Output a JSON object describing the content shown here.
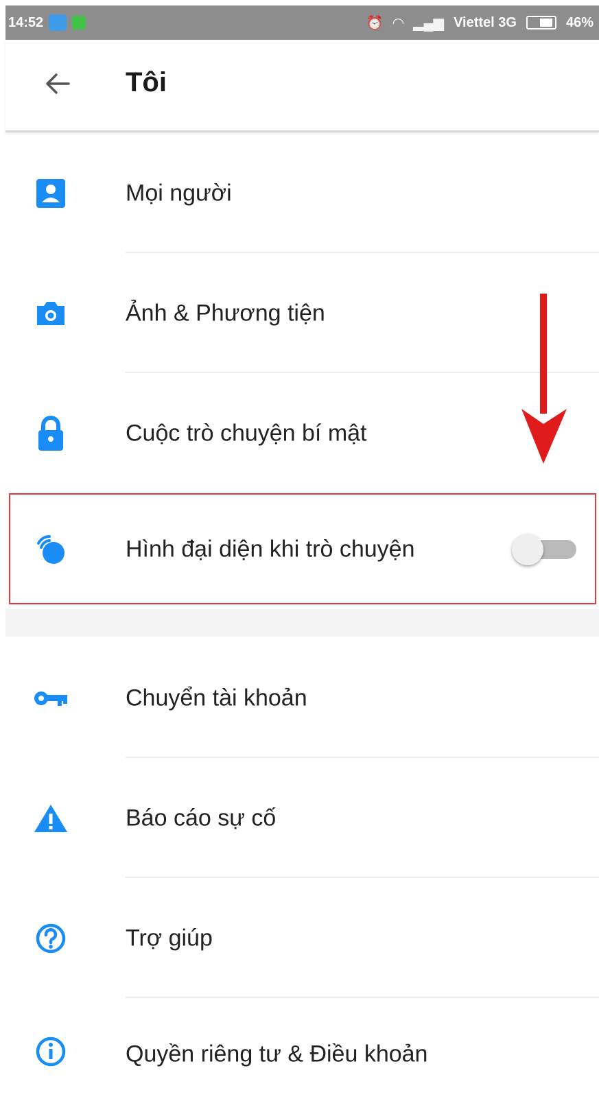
{
  "status_bar": {
    "time": "14:52",
    "carrier": "Viettel 3G",
    "battery": "46%"
  },
  "header": {
    "title": "Tôi"
  },
  "menu": {
    "items": [
      {
        "label": "Mọi người",
        "icon": "contacts-icon"
      },
      {
        "label": "Ảnh & Phương tiện",
        "icon": "camera-icon"
      },
      {
        "label": "Cuộc trò chuyện bí mật",
        "icon": "lock-icon"
      },
      {
        "label": "Hình đại diện khi trò chuyện",
        "icon": "chat-heads-icon",
        "toggle": false
      },
      {
        "label": "Chuyển tài khoản",
        "icon": "key-icon"
      },
      {
        "label": "Báo cáo sự cố",
        "icon": "warning-icon"
      },
      {
        "label": "Trợ giúp",
        "icon": "help-icon"
      },
      {
        "label": "Quyền riêng tư & Điều khoản",
        "icon": "info-icon"
      }
    ]
  },
  "colors": {
    "accent": "#1a8cf5",
    "highlight_border": "#e23c3c",
    "arrow": "#e01b1b",
    "status_bar": "#8d8d8d"
  }
}
